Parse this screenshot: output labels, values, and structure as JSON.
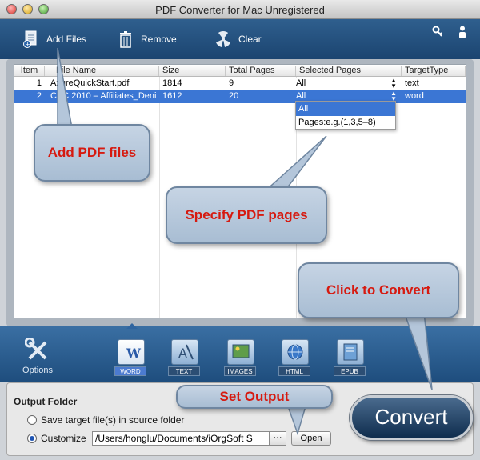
{
  "window": {
    "title": "PDF Converter for Mac Unregistered"
  },
  "toolbar": {
    "add_files": "Add Files",
    "remove": "Remove",
    "clear": "Clear"
  },
  "table": {
    "columns": [
      "Item",
      "File Name",
      "Size",
      "Total Pages",
      "Selected Pages",
      "TargetType"
    ],
    "rows": [
      {
        "item": "1",
        "file_name": "AxureQuickStart.pdf",
        "size": "1814",
        "total_pages": "9",
        "selected_pages": "All",
        "target_type": "text",
        "selected": false
      },
      {
        "item": "2",
        "file_name": "CSC 2010 – Affiliates_Deni",
        "size": "1612",
        "total_pages": "20",
        "selected_pages": "All",
        "target_type": "word",
        "selected": true
      }
    ],
    "dropdown_options": [
      "All",
      "Pages:e.g.(1,3,5–8)"
    ]
  },
  "callouts": {
    "add_pdf": "Add PDF files",
    "specify_pages": "Specify PDF pages",
    "click_convert": "Click to Convert",
    "set_output": "Set Output"
  },
  "formats": {
    "options_label": "Options",
    "items": [
      "WORD",
      "TEXT",
      "IMAGES",
      "HTML",
      "EPUB"
    ],
    "selected": "WORD"
  },
  "output": {
    "title": "Output Folder",
    "save_source_label": "Save target file(s) in source folder",
    "customize_label": "Customize",
    "path_value": "/Users/honglu/Documents/iOrgSoft S",
    "browse_label": "···",
    "open_label": "Open"
  },
  "convert_label": "Convert"
}
